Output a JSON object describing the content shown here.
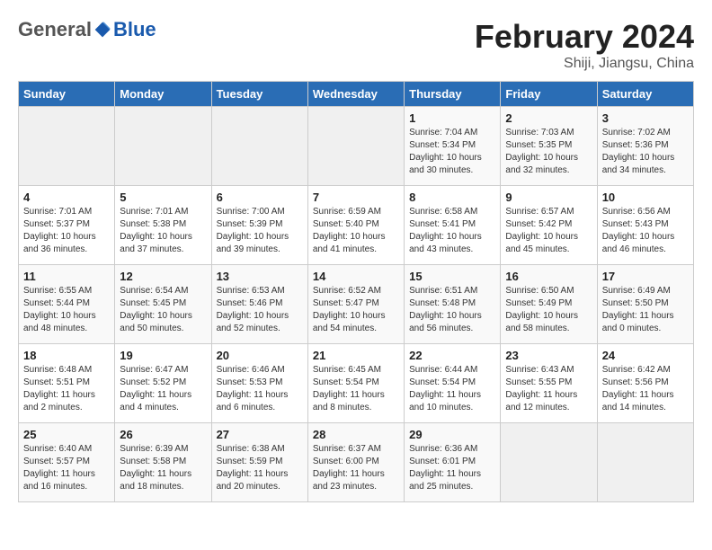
{
  "header": {
    "logo_general": "General",
    "logo_blue": "Blue",
    "title": "February 2024",
    "subtitle": "Shiji, Jiangsu, China"
  },
  "days_of_week": [
    "Sunday",
    "Monday",
    "Tuesday",
    "Wednesday",
    "Thursday",
    "Friday",
    "Saturday"
  ],
  "weeks": [
    [
      {
        "day": "",
        "info": ""
      },
      {
        "day": "",
        "info": ""
      },
      {
        "day": "",
        "info": ""
      },
      {
        "day": "",
        "info": ""
      },
      {
        "day": "1",
        "info": "Sunrise: 7:04 AM\nSunset: 5:34 PM\nDaylight: 10 hours\nand 30 minutes."
      },
      {
        "day": "2",
        "info": "Sunrise: 7:03 AM\nSunset: 5:35 PM\nDaylight: 10 hours\nand 32 minutes."
      },
      {
        "day": "3",
        "info": "Sunrise: 7:02 AM\nSunset: 5:36 PM\nDaylight: 10 hours\nand 34 minutes."
      }
    ],
    [
      {
        "day": "4",
        "info": "Sunrise: 7:01 AM\nSunset: 5:37 PM\nDaylight: 10 hours\nand 36 minutes."
      },
      {
        "day": "5",
        "info": "Sunrise: 7:01 AM\nSunset: 5:38 PM\nDaylight: 10 hours\nand 37 minutes."
      },
      {
        "day": "6",
        "info": "Sunrise: 7:00 AM\nSunset: 5:39 PM\nDaylight: 10 hours\nand 39 minutes."
      },
      {
        "day": "7",
        "info": "Sunrise: 6:59 AM\nSunset: 5:40 PM\nDaylight: 10 hours\nand 41 minutes."
      },
      {
        "day": "8",
        "info": "Sunrise: 6:58 AM\nSunset: 5:41 PM\nDaylight: 10 hours\nand 43 minutes."
      },
      {
        "day": "9",
        "info": "Sunrise: 6:57 AM\nSunset: 5:42 PM\nDaylight: 10 hours\nand 45 minutes."
      },
      {
        "day": "10",
        "info": "Sunrise: 6:56 AM\nSunset: 5:43 PM\nDaylight: 10 hours\nand 46 minutes."
      }
    ],
    [
      {
        "day": "11",
        "info": "Sunrise: 6:55 AM\nSunset: 5:44 PM\nDaylight: 10 hours\nand 48 minutes."
      },
      {
        "day": "12",
        "info": "Sunrise: 6:54 AM\nSunset: 5:45 PM\nDaylight: 10 hours\nand 50 minutes."
      },
      {
        "day": "13",
        "info": "Sunrise: 6:53 AM\nSunset: 5:46 PM\nDaylight: 10 hours\nand 52 minutes."
      },
      {
        "day": "14",
        "info": "Sunrise: 6:52 AM\nSunset: 5:47 PM\nDaylight: 10 hours\nand 54 minutes."
      },
      {
        "day": "15",
        "info": "Sunrise: 6:51 AM\nSunset: 5:48 PM\nDaylight: 10 hours\nand 56 minutes."
      },
      {
        "day": "16",
        "info": "Sunrise: 6:50 AM\nSunset: 5:49 PM\nDaylight: 10 hours\nand 58 minutes."
      },
      {
        "day": "17",
        "info": "Sunrise: 6:49 AM\nSunset: 5:50 PM\nDaylight: 11 hours\nand 0 minutes."
      }
    ],
    [
      {
        "day": "18",
        "info": "Sunrise: 6:48 AM\nSunset: 5:51 PM\nDaylight: 11 hours\nand 2 minutes."
      },
      {
        "day": "19",
        "info": "Sunrise: 6:47 AM\nSunset: 5:52 PM\nDaylight: 11 hours\nand 4 minutes."
      },
      {
        "day": "20",
        "info": "Sunrise: 6:46 AM\nSunset: 5:53 PM\nDaylight: 11 hours\nand 6 minutes."
      },
      {
        "day": "21",
        "info": "Sunrise: 6:45 AM\nSunset: 5:54 PM\nDaylight: 11 hours\nand 8 minutes."
      },
      {
        "day": "22",
        "info": "Sunrise: 6:44 AM\nSunset: 5:54 PM\nDaylight: 11 hours\nand 10 minutes."
      },
      {
        "day": "23",
        "info": "Sunrise: 6:43 AM\nSunset: 5:55 PM\nDaylight: 11 hours\nand 12 minutes."
      },
      {
        "day": "24",
        "info": "Sunrise: 6:42 AM\nSunset: 5:56 PM\nDaylight: 11 hours\nand 14 minutes."
      }
    ],
    [
      {
        "day": "25",
        "info": "Sunrise: 6:40 AM\nSunset: 5:57 PM\nDaylight: 11 hours\nand 16 minutes."
      },
      {
        "day": "26",
        "info": "Sunrise: 6:39 AM\nSunset: 5:58 PM\nDaylight: 11 hours\nand 18 minutes."
      },
      {
        "day": "27",
        "info": "Sunrise: 6:38 AM\nSunset: 5:59 PM\nDaylight: 11 hours\nand 20 minutes."
      },
      {
        "day": "28",
        "info": "Sunrise: 6:37 AM\nSunset: 6:00 PM\nDaylight: 11 hours\nand 23 minutes."
      },
      {
        "day": "29",
        "info": "Sunrise: 6:36 AM\nSunset: 6:01 PM\nDaylight: 11 hours\nand 25 minutes."
      },
      {
        "day": "",
        "info": ""
      },
      {
        "day": "",
        "info": ""
      }
    ]
  ]
}
